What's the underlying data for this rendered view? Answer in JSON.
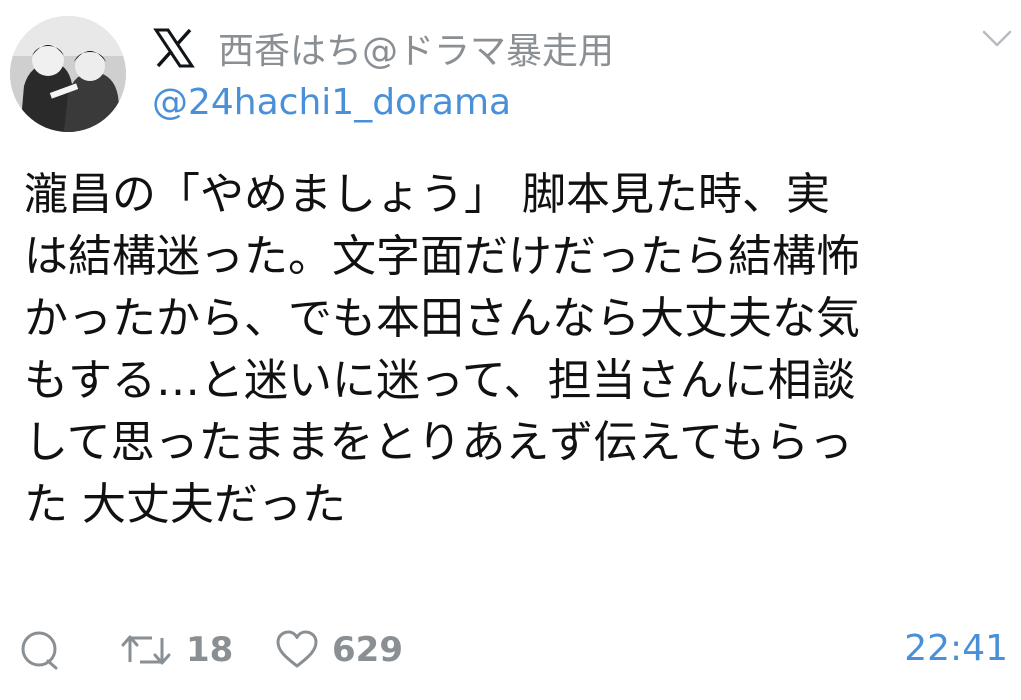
{
  "tweet": {
    "avatar_icon": "user-avatar-photo",
    "platform_icon": "x-logo-icon",
    "display_name": "西香はち@ドラマ暴走用",
    "handle": "@24hachi1_dorama",
    "menu_icon": "chevron-down-icon",
    "text_lines": [
      "瀧昌の「やめましょう」 脚本見た時、実",
      "は結構迷った。文字面だけだったら結構怖",
      "かったから、でも本田さんなら大丈夫な気",
      "もする…と迷いに迷って、担当さんに相談",
      "して思ったままをとりあえず伝えてもらっ",
      "た 大丈夫だった"
    ],
    "actions": {
      "reply_icon": "reply-icon",
      "retweet_icon": "retweet-icon",
      "retweet_count": "18",
      "like_icon": "heart-icon",
      "like_count": "629"
    },
    "time": "22:41"
  },
  "colors": {
    "name_gray": "#8a8f94",
    "link_blue": "#4a90d9",
    "text": "#111111"
  }
}
